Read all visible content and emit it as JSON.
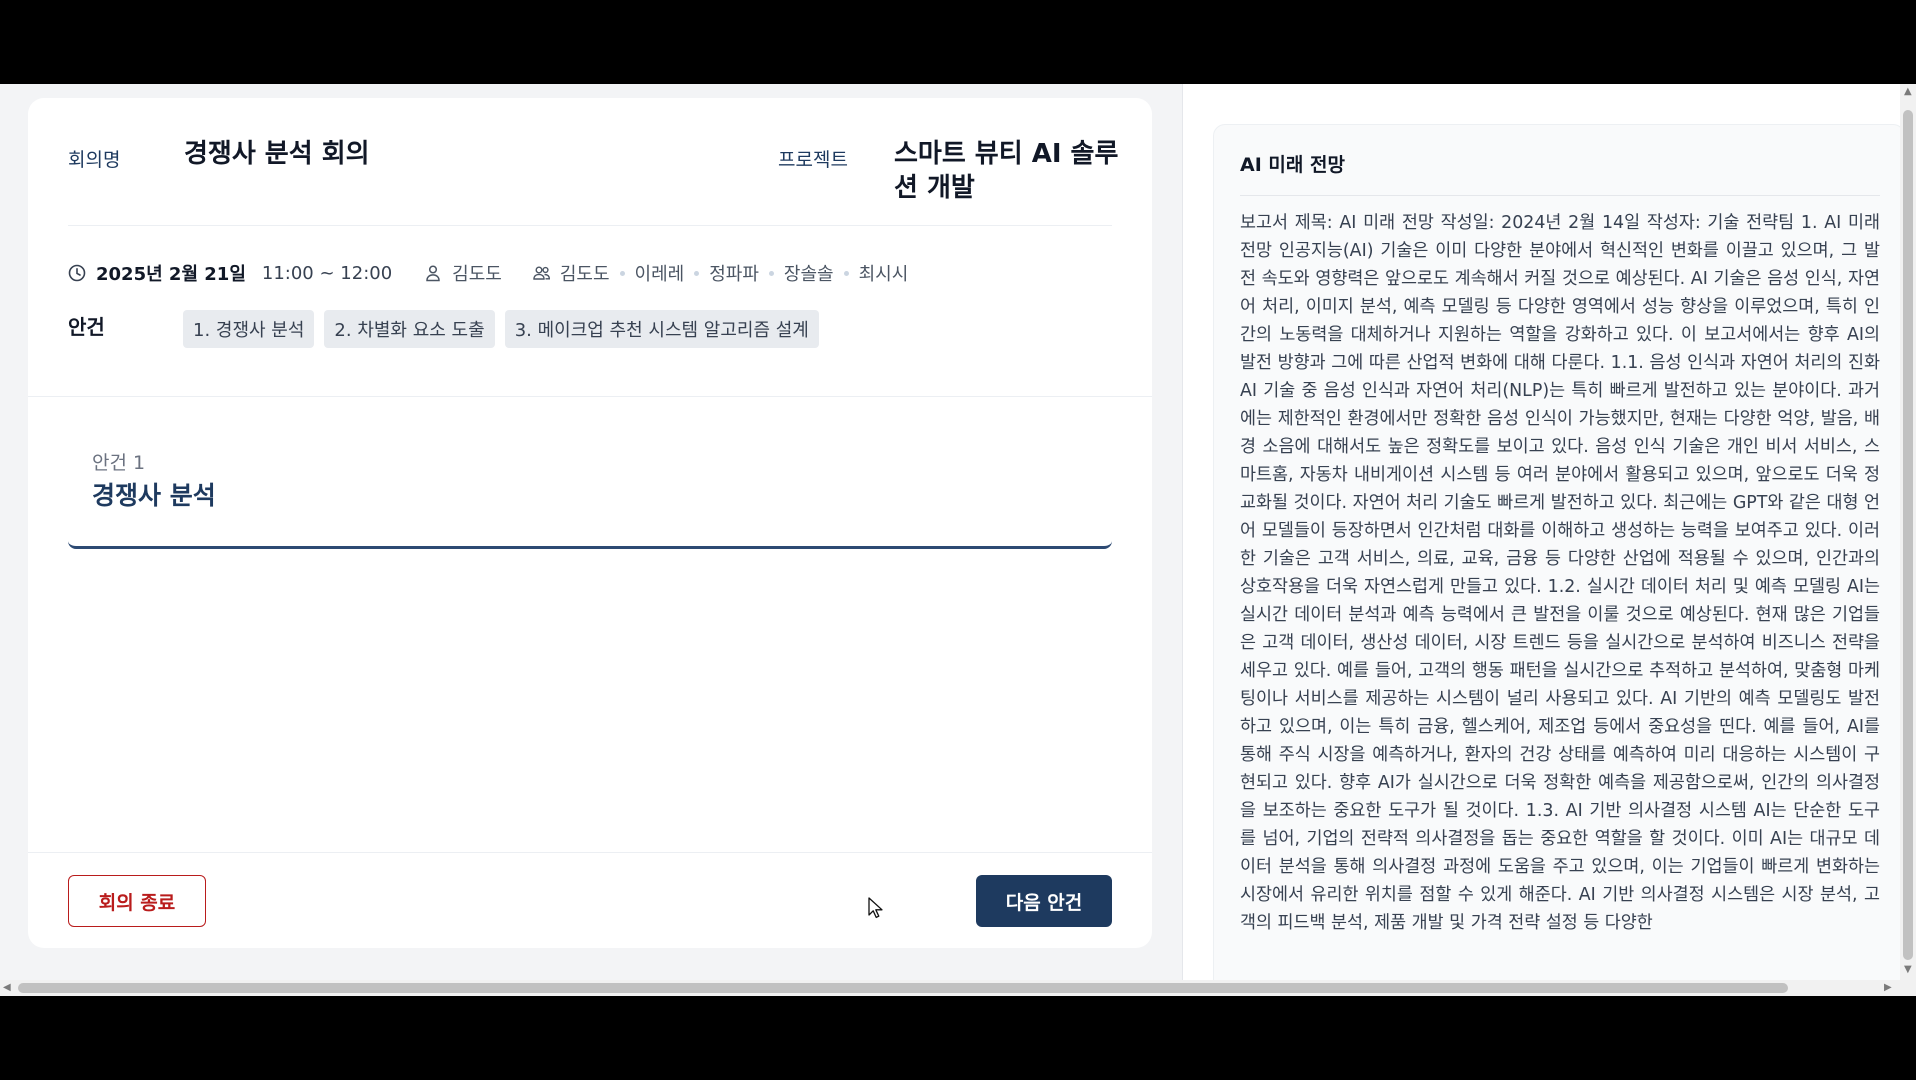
{
  "meeting": {
    "name_label": "회의명",
    "name": "경쟁사 분석 회의",
    "project_label": "프로젝트",
    "project_line1": "스마트 뷰티 AI 솔루",
    "project_line2": "션 개발",
    "date": "2025년 2월 21일",
    "time": "11:00 ~ 12:00",
    "author": "김도도",
    "participants": [
      "김도도",
      "이레레",
      "정파파",
      "장솔솔",
      "최시시"
    ]
  },
  "agenda": {
    "label": "안건",
    "items": [
      "1. 경쟁사 분석",
      "2. 차별화 요소 도출",
      "3. 메이크업 추천 시스템 알고리즘 설계"
    ],
    "current_number": "안건 1",
    "current_title": "경쟁사 분석"
  },
  "buttons": {
    "end_meeting": "회의 종료",
    "next_agenda": "다음 안건"
  },
  "report": {
    "title": "AI 미래 전망",
    "body": "보고서 제목: AI 미래 전망 작성일: 2024년 2월 14일 작성자: 기술 전략팀 1. AI 미래 전망 인공지능(AI) 기술은 이미 다양한 분야에서 혁신적인 변화를 이끌고 있으며, 그 발전 속도와 영향력은 앞으로도 계속해서 커질 것으로 예상된다. AI 기술은 음성 인식, 자연어 처리, 이미지 분석, 예측 모델링 등 다양한 영역에서 성능 향상을 이루었으며, 특히 인간의 노동력을 대체하거나 지원하는 역할을 강화하고 있다. 이 보고서에서는 향후 AI의 발전 방향과 그에 따른 산업적 변화에 대해 다룬다. 1.1. 음성 인식과 자연어 처리의 진화 AI 기술 중 음성 인식과 자연어 처리(NLP)는 특히 빠르게 발전하고 있는 분야이다. 과거에는 제한적인 환경에서만 정확한 음성 인식이 가능했지만, 현재는 다양한 억양, 발음, 배경 소음에 대해서도 높은 정확도를 보이고 있다. 음성 인식 기술은 개인 비서 서비스, 스마트홈, 자동차 내비게이션 시스템 등 여러 분야에서 활용되고 있으며, 앞으로도 더욱 정교화될 것이다. 자연어 처리 기술도 빠르게 발전하고 있다. 최근에는 GPT와 같은 대형 언어 모델들이 등장하면서 인간처럼 대화를 이해하고 생성하는 능력을 보여주고 있다. 이러한 기술은 고객 서비스, 의료, 교육, 금융 등 다양한 산업에 적용될 수 있으며, 인간과의 상호작용을 더욱 자연스럽게 만들고 있다. 1.2. 실시간 데이터 처리 및 예측 모델링 AI는 실시간 데이터 분석과 예측 능력에서 큰 발전을 이룰 것으로 예상된다. 현재 많은 기업들은 고객 데이터, 생산성 데이터, 시장 트렌드 등을 실시간으로 분석하여 비즈니스 전략을 세우고 있다. 예를 들어, 고객의 행동 패턴을 실시간으로 추적하고 분석하여, 맞춤형 마케팅이나 서비스를 제공하는 시스템이 널리 사용되고 있다. AI 기반의 예측 모델링도 발전하고 있으며, 이는 특히 금융, 헬스케어, 제조업 등에서 중요성을 띤다. 예를 들어, AI를 통해 주식 시장을 예측하거나, 환자의 건강 상태를 예측하여 미리 대응하는 시스템이 구현되고 있다. 향후 AI가 실시간으로 더욱 정확한 예측을 제공함으로써, 인간의 의사결정을 보조하는 중요한 도구가 될 것이다. 1.3. AI 기반 의사결정 시스템 AI는 단순한 도구를 넘어, 기업의 전략적 의사결정을 돕는 중요한 역할을 할 것이다. 이미 AI는 대규모 데이터 분석을 통해 의사결정 과정에 도움을 주고 있으며, 이는 기업들이 빠르게 변화하는 시장에서 유리한 위치를 점할 수 있게 해준다. AI 기반 의사결정 시스템은 시장 분석, 고객의 피드백 분석, 제품 개발 및 가격 전략 설정 등 다양한"
  },
  "colors": {
    "primary": "#1e3a5f",
    "danger": "#b91c1c",
    "background": "#f3f4f6"
  }
}
